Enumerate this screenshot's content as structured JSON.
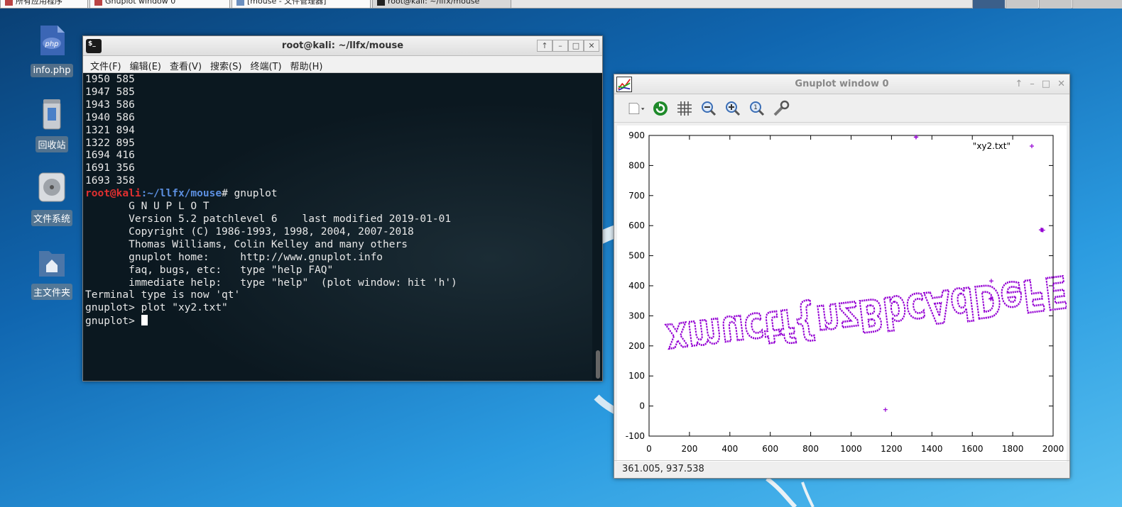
{
  "taskbar": {
    "items": [
      {
        "label": "所有应用程序"
      },
      {
        "label": "Gnuplot window 0"
      },
      {
        "label": "[mouse - 文件管理器]"
      },
      {
        "label": "root@kali: ~/llfx/mouse"
      }
    ]
  },
  "desktop": {
    "icons": [
      {
        "label": "info.php",
        "icon": "php-file-icon"
      },
      {
        "label": "回收站",
        "icon": "trash-icon"
      },
      {
        "label": "文件系统",
        "icon": "drive-icon"
      },
      {
        "label": "主文件夹",
        "icon": "home-folder-icon"
      }
    ]
  },
  "terminal": {
    "title": "root@kali: ~/llfx/mouse",
    "menu": [
      "文件(F)",
      "编辑(E)",
      "查看(V)",
      "搜索(S)",
      "终端(T)",
      "帮助(H)"
    ],
    "lines": [
      "1950 585",
      "1947 585",
      "1943 586",
      "1940 586",
      "1321 894",
      "1322 895",
      "1694 416",
      "1691 356",
      "1693 358"
    ],
    "prompt_user": "root@kali",
    "prompt_path": ":~/llfx/mouse",
    "prompt_cmd": "# gnuplot",
    "banner": [
      "",
      "       G N U P L O T",
      "       Version 5.2 patchlevel 6    last modified 2019-01-01",
      "",
      "       Copyright (C) 1986-1993, 1998, 2004, 2007-2018",
      "       Thomas Williams, Colin Kelley and many others",
      "",
      "       gnuplot home:     http://www.gnuplot.info",
      "       faq, bugs, etc:   type \"help FAQ\"",
      "       immediate help:   type \"help\"  (plot window: hit 'h')",
      "",
      "Terminal type is now 'qt'",
      "gnuplot> plot \"xy2.txt\""
    ],
    "last_prompt": "gnuplot> "
  },
  "gnuplot": {
    "title": "Gnuplot window 0",
    "toolbar": [
      "export-icon",
      "replot-icon",
      "grid-icon",
      "zoom-out-icon",
      "zoom-in-icon",
      "zoom-reset-icon",
      "settings-icon"
    ],
    "status": "361.005, 937.538"
  },
  "chart_data": {
    "type": "scatter",
    "legend": "\"xy2.txt\"",
    "legend_position": "top-right",
    "xlim": [
      0,
      2000
    ],
    "ylim": [
      -100,
      900
    ],
    "xticks": [
      0,
      200,
      400,
      600,
      800,
      1000,
      1200,
      1400,
      1600,
      1800,
      2000
    ],
    "yticks": [
      -100,
      0,
      100,
      200,
      300,
      400,
      500,
      600,
      700,
      800,
      900
    ],
    "color": "#9400d3",
    "series": [
      {
        "name": "\"xy2.txt\"",
        "x": [
          1321,
          1322,
          1694,
          1691,
          1693,
          1170,
          1950,
          1947,
          1943,
          1940
        ],
        "y": [
          894,
          895,
          416,
          356,
          358,
          -12,
          585,
          585,
          586,
          586
        ]
      }
    ],
    "handwriting_text": "xmuctf{nzBbcAdDeFEfEvEsY}HDMC}"
  }
}
